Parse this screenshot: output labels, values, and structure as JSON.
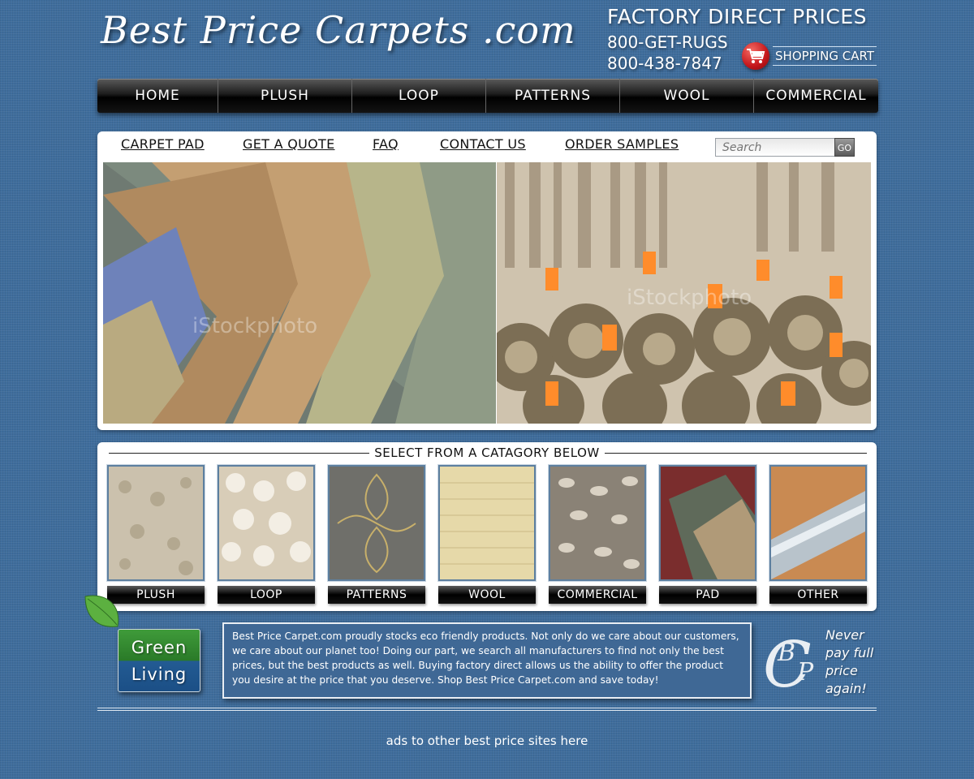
{
  "header": {
    "logo_text": "Best Price Carpets .com",
    "tagline": "FACTORY DIRECT PRICES",
    "phone_letters": "800-GET-RUGS",
    "phone_digits": "800-438-7847",
    "cart_label": "SHOPPING CART"
  },
  "main_nav": [
    {
      "label": "HOME"
    },
    {
      "label": "PLUSH"
    },
    {
      "label": "LOOP"
    },
    {
      "label": "PATTERNS"
    },
    {
      "label": "WOOL"
    },
    {
      "label": "COMMERCIAL"
    }
  ],
  "sub_nav": [
    {
      "label": "CARPET PAD"
    },
    {
      "label": "GET A QUOTE"
    },
    {
      "label": "FAQ"
    },
    {
      "label": "CONTACT US"
    },
    {
      "label": "ORDER SAMPLES"
    }
  ],
  "search": {
    "placeholder": "Search",
    "go_label": "GO"
  },
  "hero": {
    "watermark_left": "iStockphoto",
    "watermark_right": "iStockphoto"
  },
  "categories": {
    "title": "SELECT FROM A CATAGORY BELOW",
    "items": [
      {
        "label": "PLUSH"
      },
      {
        "label": "LOOP"
      },
      {
        "label": "PATTERNS"
      },
      {
        "label": "WOOL"
      },
      {
        "label": "COMMERCIAL"
      },
      {
        "label": "PAD"
      },
      {
        "label": "OTHER"
      }
    ]
  },
  "green_living": {
    "line1": "Green",
    "line2": "Living"
  },
  "eco_text": "Best Price Carpet.com proudly stocks eco friendly products. Not only do we care about our customers, we care about our planet too! Doing our part, we search all manufacturers to find not only the best prices, but the best products as well. Buying factory direct allows us the ability to offer the product you desire at the price that you deserve. Shop Best Price Carpet.com and save today!",
  "badge": {
    "monogram": [
      "C",
      "B",
      "P"
    ],
    "slogan": [
      "Never",
      "pay full",
      "price",
      "again!"
    ]
  },
  "footer": {
    "ads_text": "ads to other best price sites here"
  },
  "colors": {
    "background": "#3f6d9c",
    "nav_bar": "#000000",
    "panel": "#ffffff",
    "green_living": "#2a7a28",
    "cart_red": "#c4151a"
  },
  "icons": [
    "shopping-cart-icon",
    "leaf-icon",
    "cbp-monogram-icon"
  ]
}
